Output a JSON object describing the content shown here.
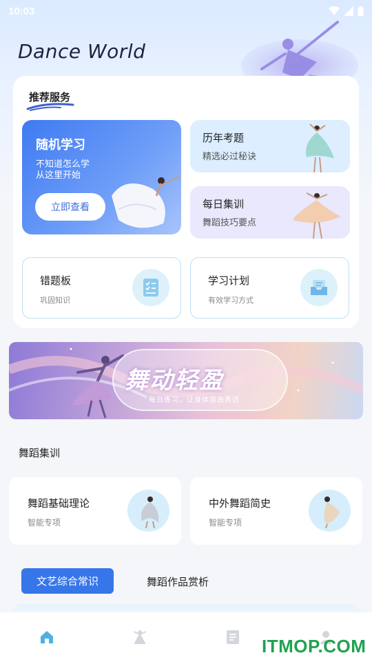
{
  "status_bar": {
    "time": "10:03"
  },
  "app": {
    "title": "Dance World"
  },
  "recommend": {
    "section_title": "推荐服务",
    "random": {
      "title": "随机学习",
      "subtitle": "不知道怎么学\n从这里开始",
      "button": "立即查看"
    },
    "exam": {
      "title": "历年考题",
      "subtitle": "精选必过秘诀"
    },
    "daily": {
      "title": "每日集训",
      "subtitle": "舞蹈技巧要点"
    },
    "wrong_book": {
      "title": "错题板",
      "subtitle": "巩固知识"
    },
    "plan": {
      "title": "学习计划",
      "subtitle": "有效学习方式"
    }
  },
  "banner": {
    "title": "舞动轻盈",
    "subtitle": "每日练习，让身体自由表达"
  },
  "training": {
    "section_title": "舞蹈集训",
    "items": [
      {
        "title": "舞蹈基础理论",
        "subtitle": "智能专项"
      },
      {
        "title": "中外舞蹈简史",
        "subtitle": "智能专项"
      }
    ]
  },
  "tabs": [
    {
      "label": "文艺综合常识",
      "active": true
    },
    {
      "label": "舞蹈作品赏析",
      "active": false
    }
  ],
  "bottom_nav": {
    "items": [
      {
        "icon": "home-icon",
        "active": true
      },
      {
        "icon": "dance-icon",
        "active": false
      },
      {
        "icon": "document-icon",
        "active": false
      },
      {
        "icon": "profile-icon",
        "active": false
      }
    ]
  },
  "watermark": "ITMOP.COM",
  "colors": {
    "accent": "#3776e9",
    "nav_active": "#4fb0e6"
  }
}
